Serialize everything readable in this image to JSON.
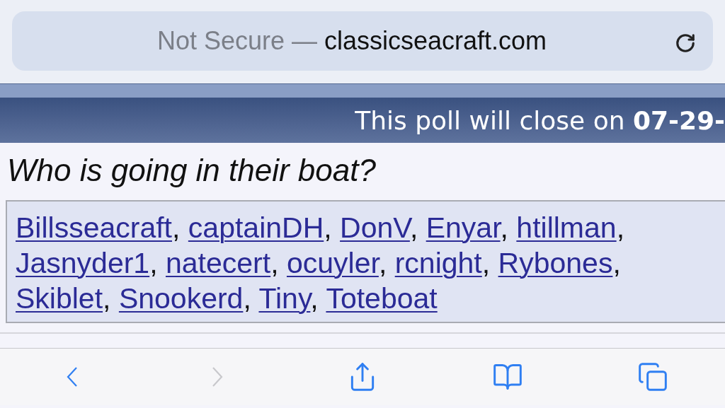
{
  "address_bar": {
    "security": "Not Secure —",
    "domain": "classicseacraft.com"
  },
  "poll_header": {
    "text": "This poll will close on **07-29-**"
  },
  "question": "Who is going in their boat?",
  "voters": [
    {
      "name": "Billsseacraft"
    },
    {
      "name": "captainDH"
    },
    {
      "name": "DonV"
    },
    {
      "name": "Enyar"
    },
    {
      "name": "htillman"
    },
    {
      "name": "Jasnyder1"
    },
    {
      "name": "natecert"
    },
    {
      "name": "ocuyler"
    },
    {
      "name": "rcnight"
    },
    {
      "name": "Rybones"
    },
    {
      "name": "Skiblet"
    },
    {
      "name": "Snookerd"
    },
    {
      "name": "Tiny"
    },
    {
      "name": "Toteboat"
    }
  ],
  "separator": ",",
  "toolbar": [
    {
      "kind": "back",
      "disabled": false
    },
    {
      "kind": "forward",
      "disabled": true
    },
    {
      "kind": "share",
      "disabled": false
    },
    {
      "kind": "bookmarks",
      "disabled": false
    },
    {
      "kind": "tabs",
      "disabled": false
    }
  ]
}
